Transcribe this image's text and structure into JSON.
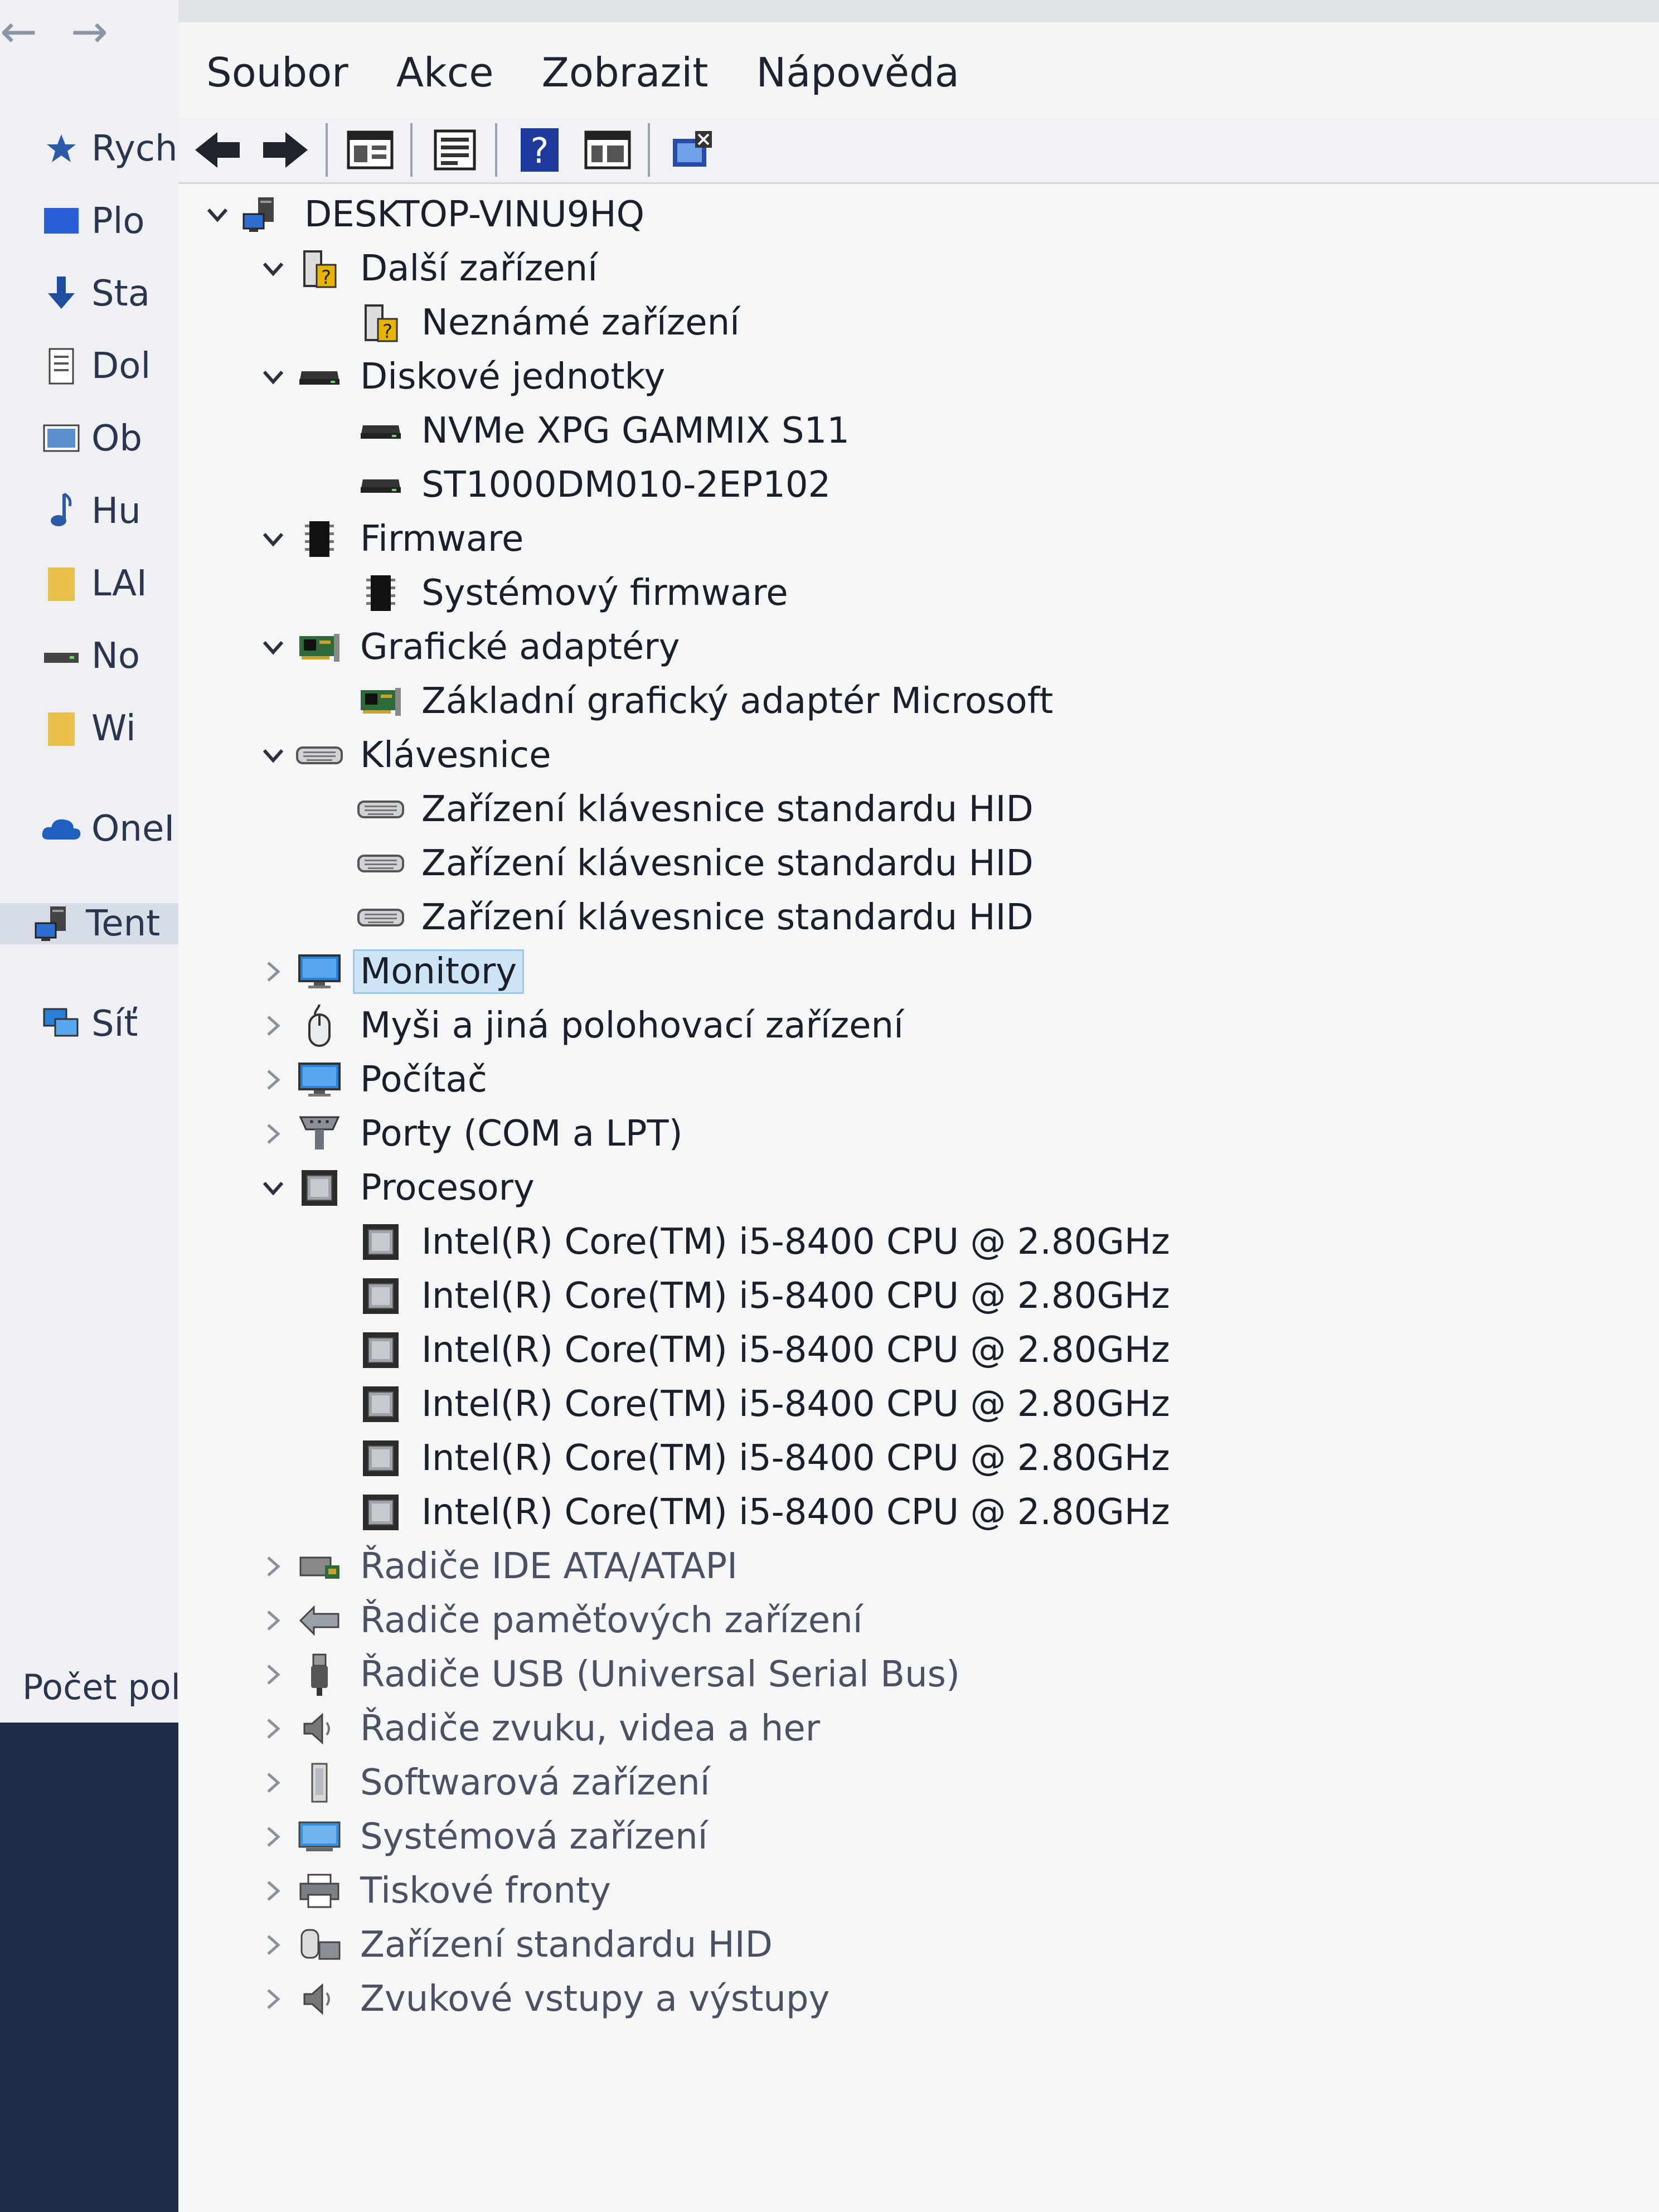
{
  "explorer": {
    "nav": [
      {
        "label": "Rych",
        "icon": "star-icon"
      },
      {
        "label": "Plo",
        "icon": "desktop-icon"
      },
      {
        "label": "Sta",
        "icon": "download-icon"
      },
      {
        "label": "Dol",
        "icon": "document-icon"
      },
      {
        "label": "Ob",
        "icon": "picture-icon"
      },
      {
        "label": "Hu",
        "icon": "music-icon"
      },
      {
        "label": "LAI",
        "icon": "folder-icon"
      },
      {
        "label": "No",
        "icon": "drive-icon"
      },
      {
        "label": "Wi",
        "icon": "folder-icon"
      },
      {
        "label": "OneI",
        "icon": "cloud-icon"
      },
      {
        "label": "Tent",
        "icon": "computer-icon"
      },
      {
        "label": "Síť",
        "icon": "network-icon"
      }
    ],
    "status": "Počet polo"
  },
  "devmgr": {
    "menu": [
      "Soubor",
      "Akce",
      "Zobrazit",
      "Nápověda"
    ],
    "toolbar": [
      "back-icon",
      "forward-icon",
      "properties-icon",
      "update-icon",
      "help-icon",
      "view-icon",
      "scan-icon"
    ],
    "tree": [
      {
        "label": "DESKTOP-VINU9HQ",
        "level": 0,
        "expander": "expanded",
        "icon": "computer-icon"
      },
      {
        "label": "Další zařízení",
        "level": 1,
        "expander": "expanded",
        "icon": "unknown-device-icon"
      },
      {
        "label": "Neznámé zařízení",
        "level": 2,
        "expander": "none",
        "icon": "unknown-device-icon"
      },
      {
        "label": "Diskové jednotky",
        "level": 1,
        "expander": "expanded",
        "icon": "disk-icon"
      },
      {
        "label": "NVMe XPG GAMMIX S11",
        "level": 2,
        "expander": "none",
        "icon": "disk-icon"
      },
      {
        "label": "ST1000DM010-2EP102",
        "level": 2,
        "expander": "none",
        "icon": "disk-icon"
      },
      {
        "label": "Firmware",
        "level": 1,
        "expander": "expanded",
        "icon": "chip-icon"
      },
      {
        "label": "Systémový firmware",
        "level": 2,
        "expander": "none",
        "icon": "chip-icon"
      },
      {
        "label": "Grafické adaptéry",
        "level": 1,
        "expander": "expanded",
        "icon": "display-adapter-icon"
      },
      {
        "label": "Základní grafický adaptér Microsoft",
        "level": 2,
        "expander": "none",
        "icon": "display-adapter-icon"
      },
      {
        "label": "Klávesnice",
        "level": 1,
        "expander": "expanded",
        "icon": "keyboard-icon"
      },
      {
        "label": "Zařízení klávesnice standardu HID",
        "level": 2,
        "expander": "none",
        "icon": "keyboard-icon"
      },
      {
        "label": "Zařízení klávesnice standardu HID",
        "level": 2,
        "expander": "none",
        "icon": "keyboard-icon"
      },
      {
        "label": "Zařízení klávesnice standardu HID",
        "level": 2,
        "expander": "none",
        "icon": "keyboard-icon"
      },
      {
        "label": "Monitory",
        "level": 1,
        "expander": "collapsed",
        "icon": "monitor-icon",
        "selected": true
      },
      {
        "label": "Myši a jiná polohovací zařízení",
        "level": 1,
        "expander": "collapsed",
        "icon": "mouse-icon"
      },
      {
        "label": "Počítač",
        "level": 1,
        "expander": "collapsed",
        "icon": "monitor-icon"
      },
      {
        "label": "Porty (COM a LPT)",
        "level": 1,
        "expander": "collapsed",
        "icon": "port-icon"
      },
      {
        "label": "Procesory",
        "level": 1,
        "expander": "expanded",
        "icon": "processor-icon"
      },
      {
        "label": "Intel(R) Core(TM) i5-8400 CPU @ 2.80GHz",
        "level": 2,
        "expander": "none",
        "icon": "processor-icon"
      },
      {
        "label": "Intel(R) Core(TM) i5-8400 CPU @ 2.80GHz",
        "level": 2,
        "expander": "none",
        "icon": "processor-icon"
      },
      {
        "label": "Intel(R) Core(TM) i5-8400 CPU @ 2.80GHz",
        "level": 2,
        "expander": "none",
        "icon": "processor-icon"
      },
      {
        "label": "Intel(R) Core(TM) i5-8400 CPU @ 2.80GHz",
        "level": 2,
        "expander": "none",
        "icon": "processor-icon"
      },
      {
        "label": "Intel(R) Core(TM) i5-8400 CPU @ 2.80GHz",
        "level": 2,
        "expander": "none",
        "icon": "processor-icon"
      },
      {
        "label": "Intel(R) Core(TM) i5-8400 CPU @ 2.80GHz",
        "level": 2,
        "expander": "none",
        "icon": "processor-icon"
      },
      {
        "label": "Řadiče IDE ATA/ATAPI",
        "level": 1,
        "expander": "collapsed",
        "icon": "ide-controller-icon"
      },
      {
        "label": "Řadiče paměťových zařízení",
        "level": 1,
        "expander": "collapsed",
        "icon": "storage-controller-icon"
      },
      {
        "label": "Řadiče USB (Universal Serial Bus)",
        "level": 1,
        "expander": "collapsed",
        "icon": "usb-icon"
      },
      {
        "label": "Řadiče zvuku, videa a her",
        "level": 1,
        "expander": "collapsed",
        "icon": "speaker-icon"
      },
      {
        "label": "Softwarová zařízení",
        "level": 1,
        "expander": "collapsed",
        "icon": "software-device-icon"
      },
      {
        "label": "Systémová zařízení",
        "level": 1,
        "expander": "collapsed",
        "icon": "system-device-icon"
      },
      {
        "label": "Tiskové fronty",
        "level": 1,
        "expander": "collapsed",
        "icon": "printer-icon"
      },
      {
        "label": "Zařízení standardu HID",
        "level": 1,
        "expander": "collapsed",
        "icon": "hid-icon"
      },
      {
        "label": "Zvukové vstupy a výstupy",
        "level": 1,
        "expander": "collapsed",
        "icon": "speaker-icon"
      }
    ]
  }
}
